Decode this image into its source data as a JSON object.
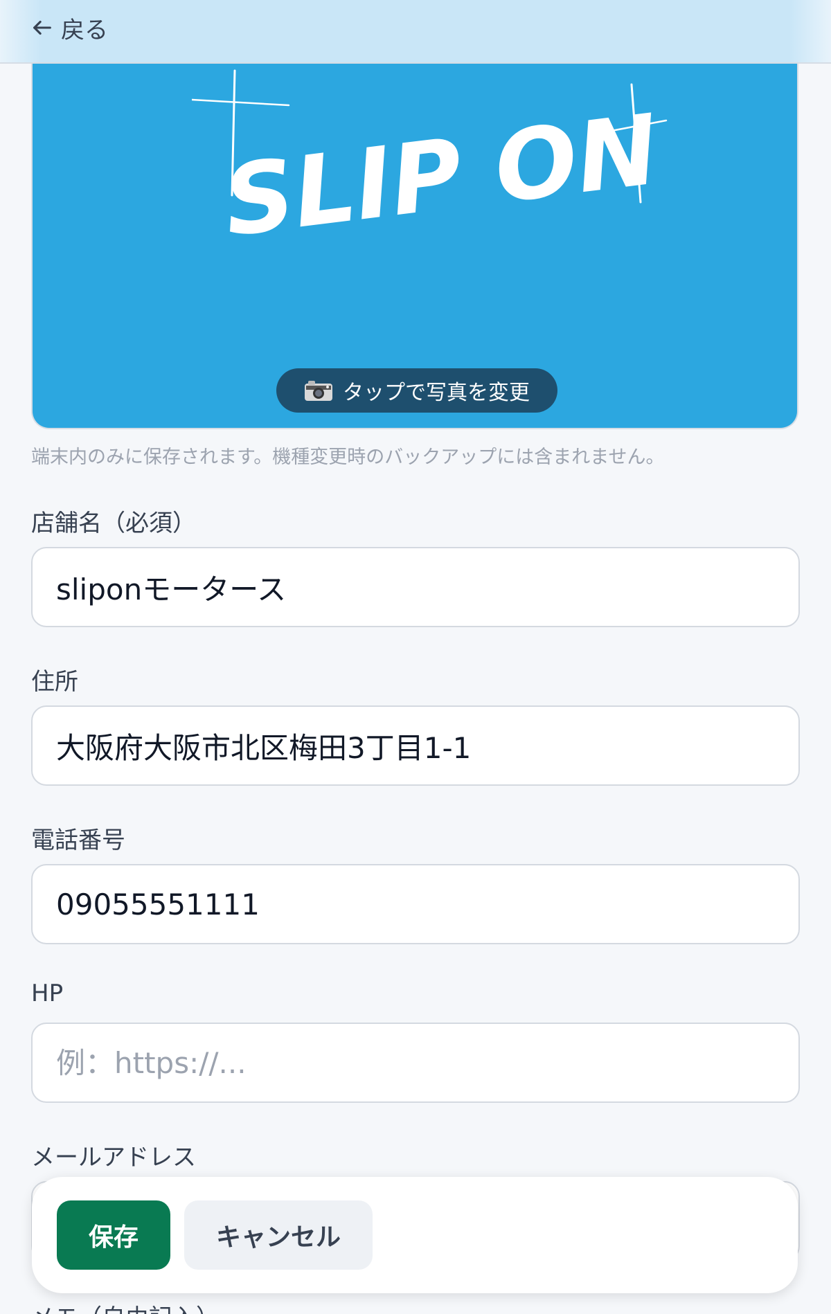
{
  "header": {
    "back_label": "戻る",
    "back_icon": "arrow-left-icon"
  },
  "hero": {
    "logo_text": "SLIP ON",
    "photo_button_label": "タップで写真を変更",
    "photo_button_icon": "camera-icon",
    "background_color": "#2ca7e0"
  },
  "note": "端末内のみに保存されます。機種変更時のバックアップには含まれません。",
  "form": {
    "shop_name": {
      "label": "店舗名（必須）",
      "value": "sliponモータース"
    },
    "address": {
      "label": "住所",
      "value": "大阪府大阪市北区梅田3丁目1-1"
    },
    "phone": {
      "label": "電話番号",
      "value": "09055551111"
    },
    "hp": {
      "label": "HP",
      "value": "",
      "placeholder": "例：https://..."
    },
    "email": {
      "label": "メールアドレス",
      "value": ""
    },
    "memo": {
      "label": "メモ（自由記入）"
    }
  },
  "actions": {
    "save_label": "保存",
    "cancel_label": "キャンセル",
    "save_color": "#097a52"
  }
}
